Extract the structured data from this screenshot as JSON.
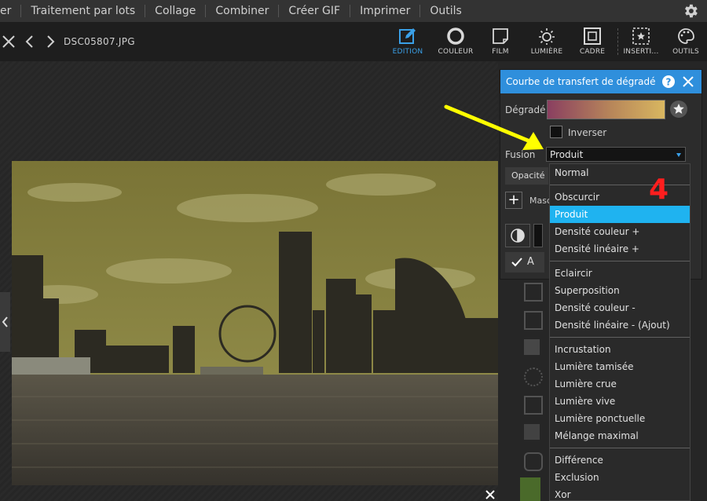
{
  "menubar": {
    "items": [
      "er",
      "Traitement par lots",
      "Collage",
      "Combiner",
      "Créer GIF",
      "Imprimer",
      "Outils"
    ]
  },
  "toolbar": {
    "filename": "DSC05807.JPG",
    "tools": [
      {
        "label": "EDITION",
        "icon": "edit-icon",
        "active": true
      },
      {
        "label": "COULEUR",
        "icon": "color-circle-icon",
        "active": false
      },
      {
        "label": "FILM",
        "icon": "film-icon",
        "active": false
      },
      {
        "label": "LUMIÈRE",
        "icon": "light-icon",
        "active": false
      },
      {
        "label": "CADRE",
        "icon": "frame-icon",
        "active": false
      },
      {
        "label": "INSERTI...",
        "icon": "insert-icon",
        "active": false
      },
      {
        "label": "OUTILS",
        "icon": "palette-icon",
        "active": false
      }
    ]
  },
  "dialog": {
    "title": "Courbe de transfert de dégradé",
    "gradient_label": "Dégradé",
    "invert_label": "Inverser",
    "fusion_label": "Fusion",
    "fusion_value": "Produit",
    "opacity_label": "Opacité",
    "mask_label": "Masq",
    "apply_label": "A",
    "gradient_colors": [
      "#8a3f60",
      "#d9b760"
    ]
  },
  "dropdown": {
    "selected": "Produit",
    "groups": [
      [
        "Normal"
      ],
      [
        "Obscurcir",
        "Produit",
        "Densité couleur +",
        "Densité linéaire +"
      ],
      [
        "Eclaircir",
        "Superposition",
        "Densité couleur -",
        "Densité linéaire - (Ajout)"
      ],
      [
        "Incrustation",
        "Lumière tamisée",
        "Lumière crue",
        "Lumière vive",
        "Lumière ponctuelle",
        "Mélange maximal"
      ],
      [
        "Différence",
        "Exclusion",
        "Xor"
      ]
    ]
  },
  "annotation": {
    "step_number": "4",
    "arrow_color": "#ffff00",
    "number_color": "#ff1e1e"
  },
  "colors": {
    "accent": "#2f8fdc",
    "selected_option": "#1fb3f0"
  }
}
